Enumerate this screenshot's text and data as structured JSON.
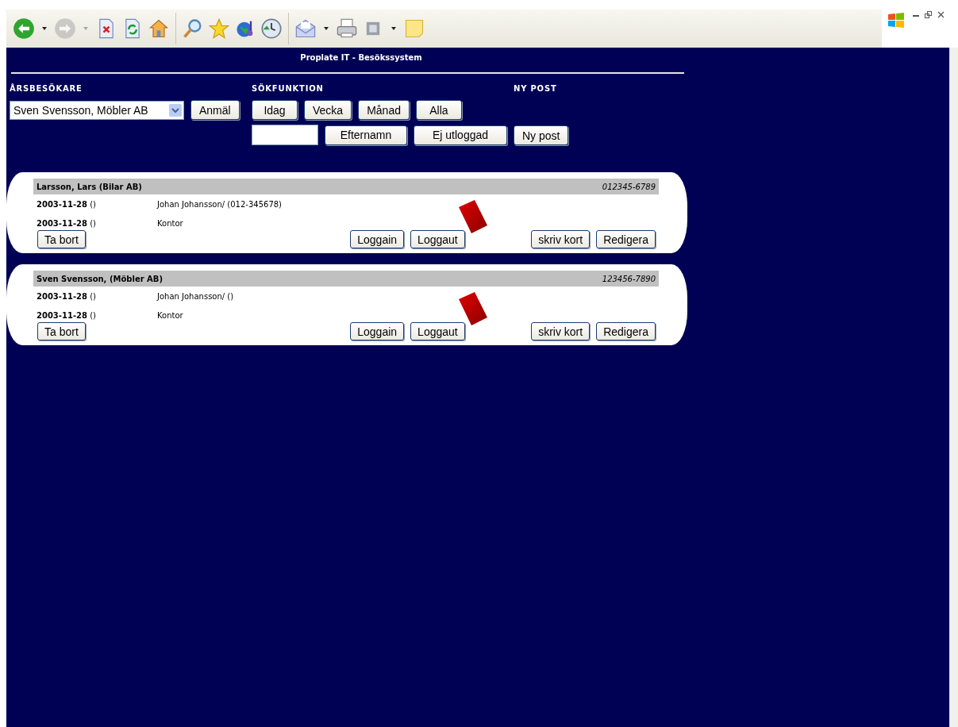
{
  "toolbar": {
    "buttons": [
      {
        "kind": "back",
        "disabled": false,
        "menu": true
      },
      {
        "kind": "forward",
        "disabled": true,
        "menu": true
      },
      {
        "kind": "stop",
        "disabled": false,
        "menu": false
      },
      {
        "kind": "refresh",
        "disabled": false,
        "menu": false
      },
      {
        "kind": "home",
        "disabled": false,
        "menu": false
      },
      {
        "kind": "search",
        "disabled": false,
        "menu": false
      },
      {
        "kind": "favorites",
        "disabled": false,
        "menu": false
      },
      {
        "kind": "media",
        "disabled": false,
        "menu": false
      },
      {
        "kind": "history",
        "disabled": false,
        "menu": false
      },
      {
        "kind": "mail",
        "disabled": false,
        "menu": true
      },
      {
        "kind": "print",
        "disabled": false,
        "menu": false
      },
      {
        "kind": "window",
        "disabled": false,
        "menu": true
      },
      {
        "kind": "note",
        "disabled": false,
        "menu": false
      }
    ]
  },
  "page": {
    "title": "Proplate IT - Besökssystem",
    "visitors": {
      "label": "ÅRSBESÖKARE",
      "select_value": "Sven Svensson, Möbler AB",
      "button": "Anmäl"
    },
    "search": {
      "label": "SÖKFUNKTION",
      "period_buttons": [
        "Idag",
        "Vecka",
        "Månad",
        "Alla"
      ],
      "buttons": [
        "Efternamn",
        "Ej utloggad"
      ]
    },
    "new_post": {
      "label": "NY POST",
      "button": "Ny post"
    },
    "records": [
      {
        "name": "Larsson, Lars (Bilar AB)",
        "number": "012345-6789",
        "lines": [
          {
            "date": "**2003-11-28** ()",
            "text": "Johan Johansson/ (012-345678)"
          },
          {
            "date": "**2003-11-28** ()",
            "text": "Kontor"
          }
        ],
        "buttons": {
          "delete": "Ta bort",
          "login": "Loggain",
          "logout": "Loggaut",
          "print_card": "skriv kort",
          "edit": "Redigera"
        }
      },
      {
        "name": "Sven Svensson, (Möbler AB)",
        "number": "123456-7890",
        "lines": [
          {
            "date": "**2003-11-28** ()",
            "text": "Johan Johansson/ ()"
          },
          {
            "date": "**2003-11-28** ()",
            "text": "Kontor"
          }
        ],
        "buttons": {
          "delete": "Ta bort",
          "login": "Loggain",
          "logout": "Loggaut",
          "print_card": "skriv kort",
          "edit": "Redigera"
        }
      }
    ]
  }
}
